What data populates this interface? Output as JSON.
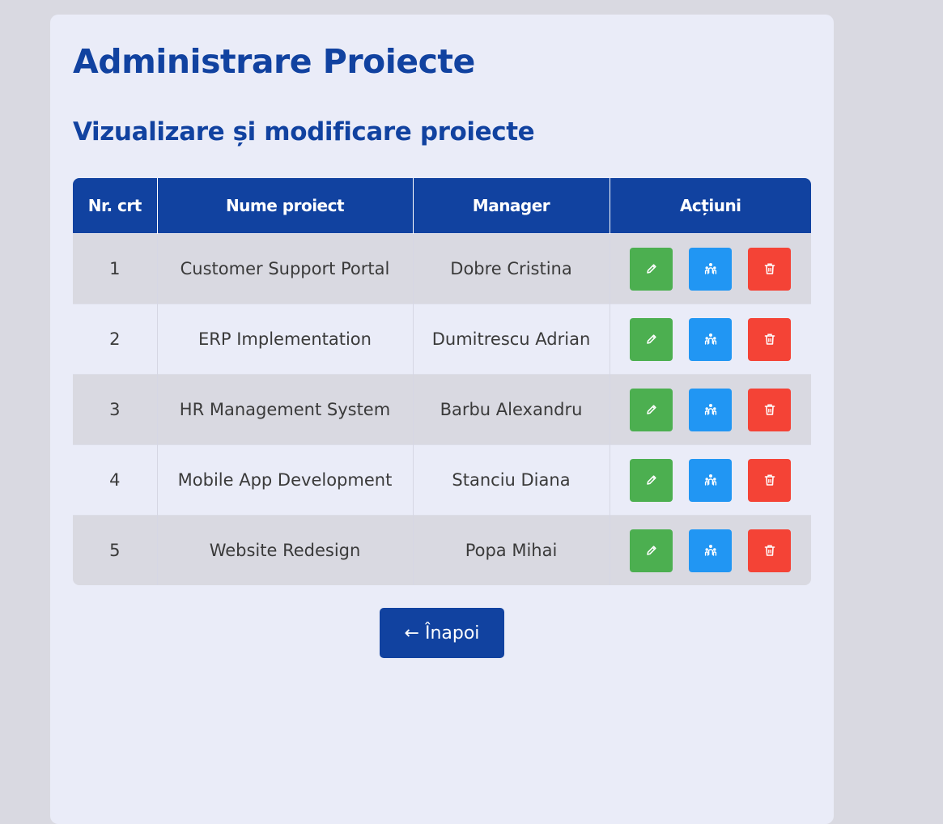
{
  "page": {
    "title": "Administrare Proiecte",
    "subtitle": "Vizualizare și modificare proiecte"
  },
  "table": {
    "headers": [
      "Nr. crt",
      "Nume proiect",
      "Manager",
      "Acțiuni"
    ],
    "rows": [
      {
        "nr": "1",
        "name": "Customer Support Portal",
        "manager": "Dobre Cristina"
      },
      {
        "nr": "2",
        "name": "ERP Implementation",
        "manager": "Dumitrescu Adrian"
      },
      {
        "nr": "3",
        "name": "HR Management System",
        "manager": "Barbu Alexandru"
      },
      {
        "nr": "4",
        "name": "Mobile App Development",
        "manager": "Stanciu Diana"
      },
      {
        "nr": "5",
        "name": "Website Redesign",
        "manager": "Popa Mihai"
      }
    ],
    "action_icons": [
      "pencil-icon",
      "team-icon",
      "trash-icon"
    ]
  },
  "back_button": {
    "label": "← Înapoi"
  },
  "colors": {
    "primary": "#1142a0",
    "edit": "#4caf50",
    "team": "#2196f3",
    "delete": "#f44336",
    "background": "#d9d9e1",
    "card": "#eaecf8"
  }
}
